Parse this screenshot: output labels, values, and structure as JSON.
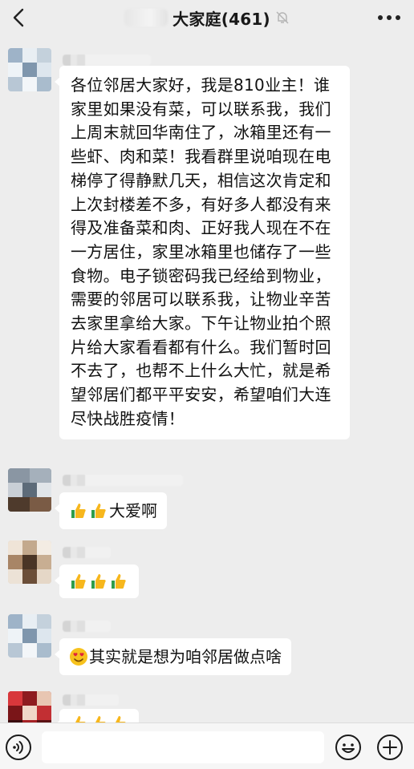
{
  "header": {
    "title": "大家庭(461)",
    "icons": [
      "back-arrow-icon",
      "mute-bell-icon",
      "more-dots-icon"
    ]
  },
  "messages": [
    {
      "type": "text",
      "text": "各位邻居大家好，我是810业主！谁家里如果没有菜，可以联系我，我们上周末就回华南住了，冰箱里还有一些虾、肉和菜！我看群里说咱现在电梯停了得静默几天，相信这次肯定和上次封楼差不多，有好多人都没有来得及准备菜和肉、正好我人现在不在一方居住，家里冰箱里也储存了一些食物。电子锁密码我已经给到物业，需要的邻居可以联系我，让物业辛苦去家里拿给大家。下午让物业拍个照片给大家看看都有什么。我们暂时回不去了，也帮不上什么大忙，就是希望邻居们都平平安安，希望咱们大连尽快战胜疫情！"
    },
    {
      "type": "emoji-text",
      "emojis": [
        "thumbs-up-icon",
        "thumbs-up-icon"
      ],
      "text": "大爱啊"
    },
    {
      "type": "emoji-only",
      "emojis": [
        "thumbs-up-icon",
        "thumbs-up-icon",
        "thumbs-up-icon"
      ]
    },
    {
      "type": "emoji-text",
      "emojis": [
        "heart-eyes-icon"
      ],
      "text": "其实就是想为咱邻居做点啥"
    },
    {
      "type": "emoji-only",
      "emojis": [
        "thumbs-up-icon",
        "thumbs-up-icon",
        "thumbs-up-icon"
      ]
    }
  ],
  "footer": {
    "icons": [
      "voice-icon",
      "emoji-button-icon",
      "plus-icon"
    ]
  }
}
